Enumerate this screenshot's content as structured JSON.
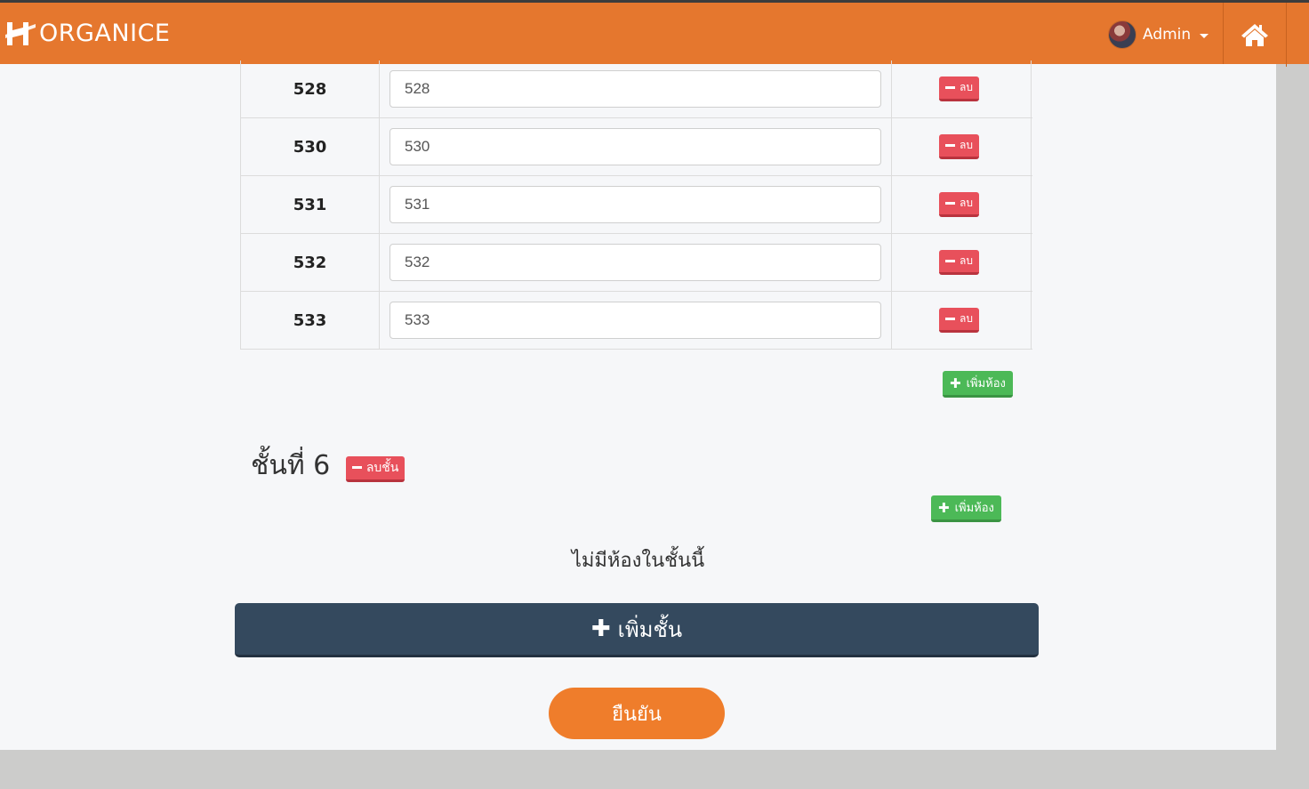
{
  "navbar": {
    "brand": "ORGANICE",
    "user_label": "Admin",
    "accent": "#e5772e"
  },
  "icons": {
    "brand": "brand-logo-icon",
    "home": "home-icon",
    "caret": "caret-down-icon",
    "minus": "minus-icon",
    "plus": "plus-icon"
  },
  "rooms": [
    {
      "number": "528",
      "value": "528",
      "delete_label": "ลบ"
    },
    {
      "number": "530",
      "value": "530",
      "delete_label": "ลบ"
    },
    {
      "number": "531",
      "value": "531",
      "delete_label": "ลบ"
    },
    {
      "number": "532",
      "value": "532",
      "delete_label": "ลบ"
    },
    {
      "number": "533",
      "value": "533",
      "delete_label": "ลบ"
    }
  ],
  "floor5": {
    "add_room_label": "เพิ่มห้อง"
  },
  "floor6": {
    "title": "ชั้นที่ 6",
    "delete_floor_label": "ลบชั้น",
    "add_room_label": "เพิ่มห้อง",
    "empty_message": "ไม่มีห้องในชั้นนี้"
  },
  "actions": {
    "add_floor_label": "เพิ่มชั้น",
    "confirm_label": "ยืนยัน"
  },
  "colors": {
    "navbar": "#e5772e",
    "danger": "#e8505b",
    "success": "#4cb957",
    "dark_button": "#34495e",
    "confirm": "#ef7d2b"
  }
}
